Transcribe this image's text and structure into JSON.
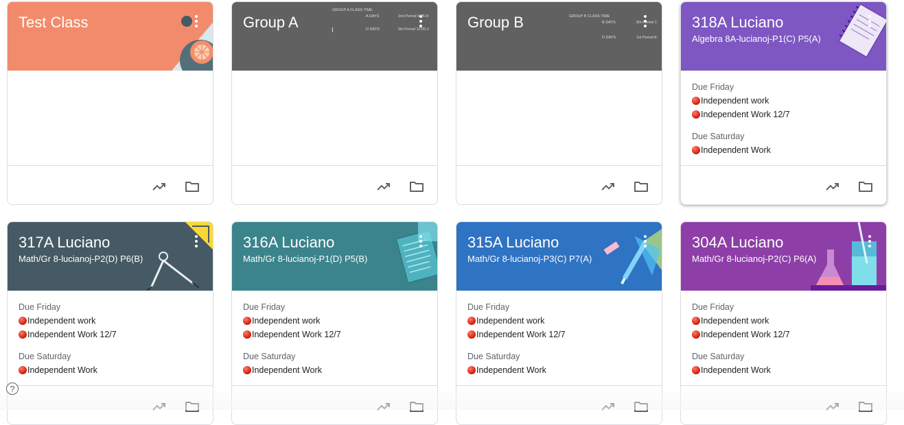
{
  "cards": [
    {
      "title": "Test Class",
      "subtitle": "",
      "color": "#f28b6b",
      "due": []
    },
    {
      "title": "Group A",
      "subtitle": "",
      "color": "#616161",
      "due": [],
      "schedule": {
        "header": "GROUP A  CLASS TIME",
        "row1_days": "A DAYS",
        "row1_time": "2nd Period 9:05-9:",
        "row2_days": "D DAYS",
        "row2_time": "5th Period 12:00-1"
      }
    },
    {
      "title": "Group B",
      "subtitle": "",
      "color": "#616161",
      "due": [],
      "schedule": {
        "header": "GROUP B  CLASS TIME",
        "row1_days": "B DAYS",
        "row1_time": "5th Period 1:",
        "row2_days": "D DAYS",
        "row2_time": "1st Period 8:"
      }
    },
    {
      "title": "318A Luciano",
      "subtitle": "Algebra 8A-lucianoj-P1(C) P5(A)",
      "color": "#7e57c2",
      "due": [
        {
          "heading": "Due Friday",
          "items": [
            "Independent work",
            "Independent Work 12/7"
          ]
        },
        {
          "heading": "Due Saturday",
          "items": [
            "Independent Work"
          ]
        }
      ]
    },
    {
      "title": "317A Luciano",
      "subtitle": "Math/Gr 8-lucianoj-P2(D) P6(B)",
      "color": "#455a64",
      "due": [
        {
          "heading": "Due Friday",
          "items": [
            "Independent work",
            "Independent Work 12/7"
          ]
        },
        {
          "heading": "Due Saturday",
          "items": [
            "Independent Work"
          ]
        }
      ]
    },
    {
      "title": "316A Luciano",
      "subtitle": "Math/Gr 8-lucianoj-P1(D) P5(B)",
      "color": "#3b848c",
      "due": [
        {
          "heading": "Due Friday",
          "items": [
            "Independent work",
            "Independent Work 12/7"
          ]
        },
        {
          "heading": "Due Saturday",
          "items": [
            "Independent Work"
          ]
        }
      ]
    },
    {
      "title": "315A Luciano",
      "subtitle": "Math/Gr 8-lucianoj-P3(C) P7(A)",
      "color": "#2f73c3",
      "due": [
        {
          "heading": "Due Friday",
          "items": [
            "Independent work",
            "Independent Work 12/7"
          ]
        },
        {
          "heading": "Due Saturday",
          "items": [
            "Independent Work"
          ]
        }
      ]
    },
    {
      "title": "304A Luciano",
      "subtitle": "Math/Gr 8-lucianoj-P2(C) P6(A)",
      "color": "#8e3fa7",
      "due": [
        {
          "heading": "Due Friday",
          "items": [
            "Independent work",
            "Independent Work 12/7"
          ]
        },
        {
          "heading": "Due Saturday",
          "items": [
            "Independent Work"
          ]
        }
      ]
    }
  ],
  "help_label": "?"
}
